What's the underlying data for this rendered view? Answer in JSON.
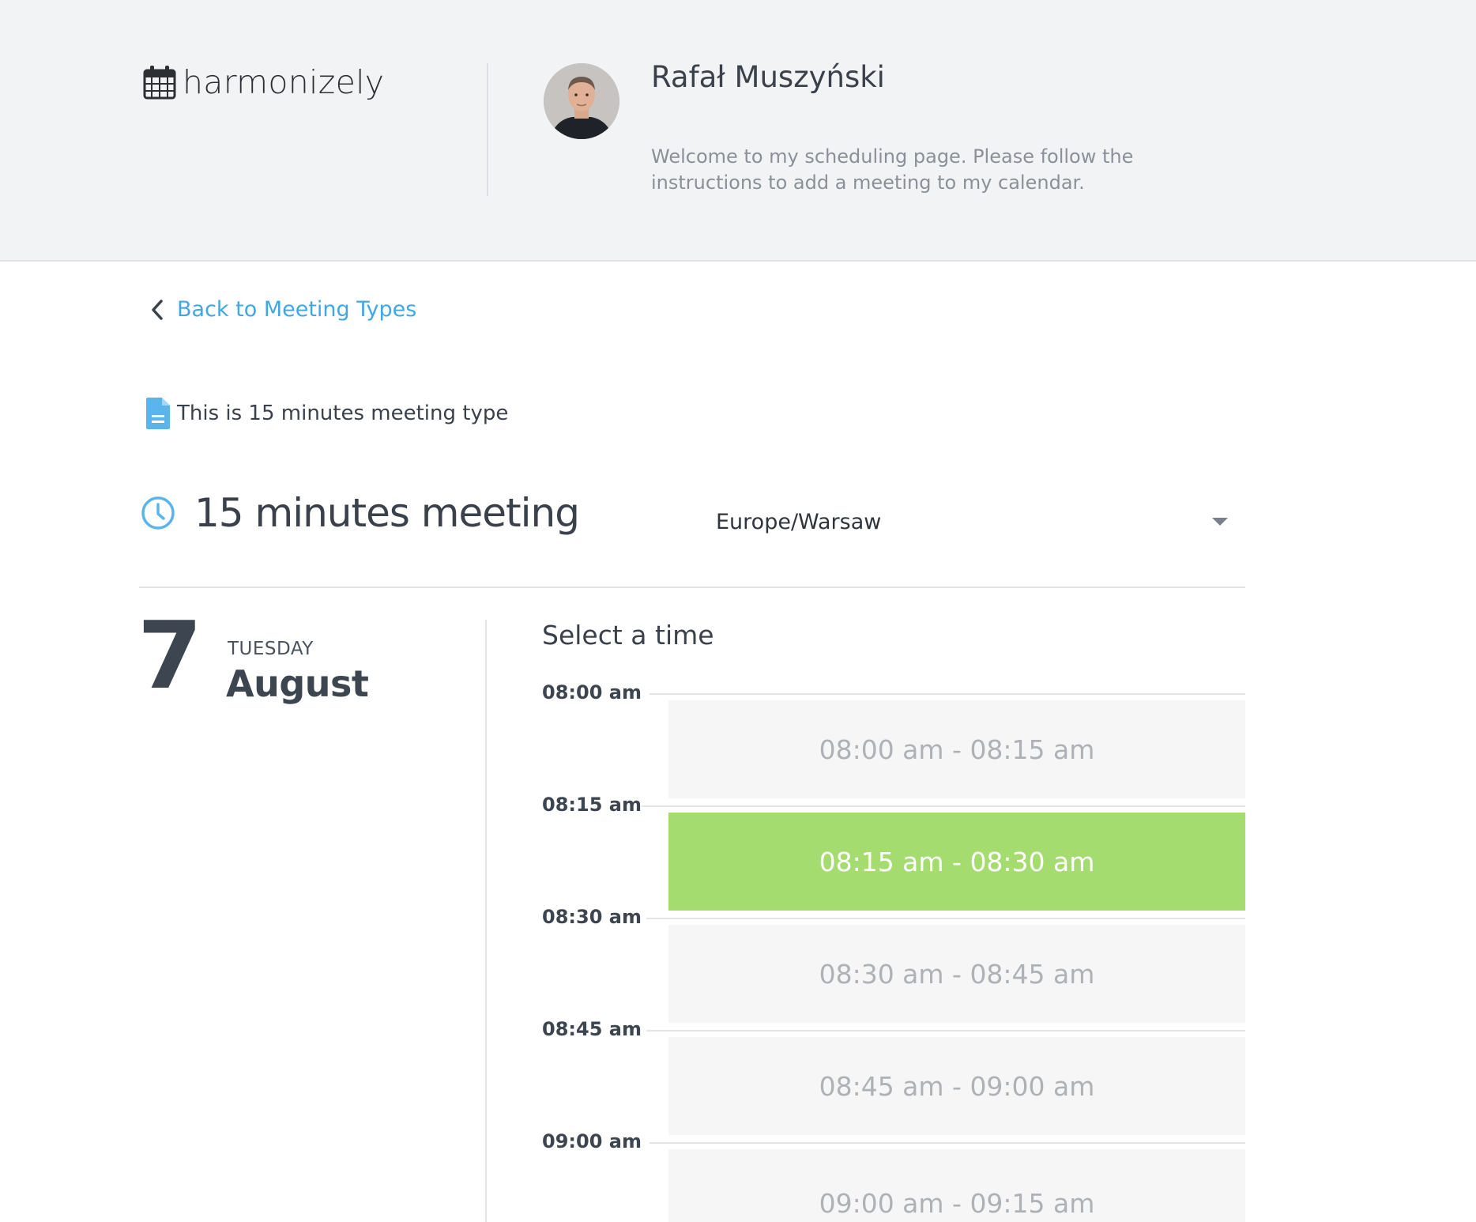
{
  "header": {
    "logo_text": "harmonizely",
    "host_name": "Rafał Muszyński",
    "welcome": "Welcome to my scheduling page. Please follow the instructions to add a meeting to my calendar."
  },
  "nav": {
    "back_label": "Back to Meeting Types"
  },
  "meeting": {
    "description": "This is 15 minutes meeting type",
    "title": "15 minutes meeting",
    "timezone": "Europe/Warsaw"
  },
  "date": {
    "day": "7",
    "weekday": "TUESDAY",
    "month": "August"
  },
  "times": {
    "heading": "Select a time",
    "labels": [
      "08:00 am",
      "08:15 am",
      "08:30 am",
      "08:45 am",
      "09:00 am"
    ],
    "slots": [
      {
        "label": "08:00 am - 08:15 am",
        "selected": false
      },
      {
        "label": "08:15 am - 08:30 am",
        "selected": true
      },
      {
        "label": "08:30 am - 08:45 am",
        "selected": false
      },
      {
        "label": "08:45 am - 09:00 am",
        "selected": false
      },
      {
        "label": "09:00 am - 09:15 am",
        "selected": false
      }
    ]
  },
  "colors": {
    "accent": "#3fa8e4",
    "selected_slot": "#a5dc6f"
  },
  "icons": {
    "logo": "calendar-icon",
    "back": "chevron-left-icon",
    "description": "document-icon",
    "meeting": "clock-icon",
    "timezone": "caret-down-icon"
  }
}
